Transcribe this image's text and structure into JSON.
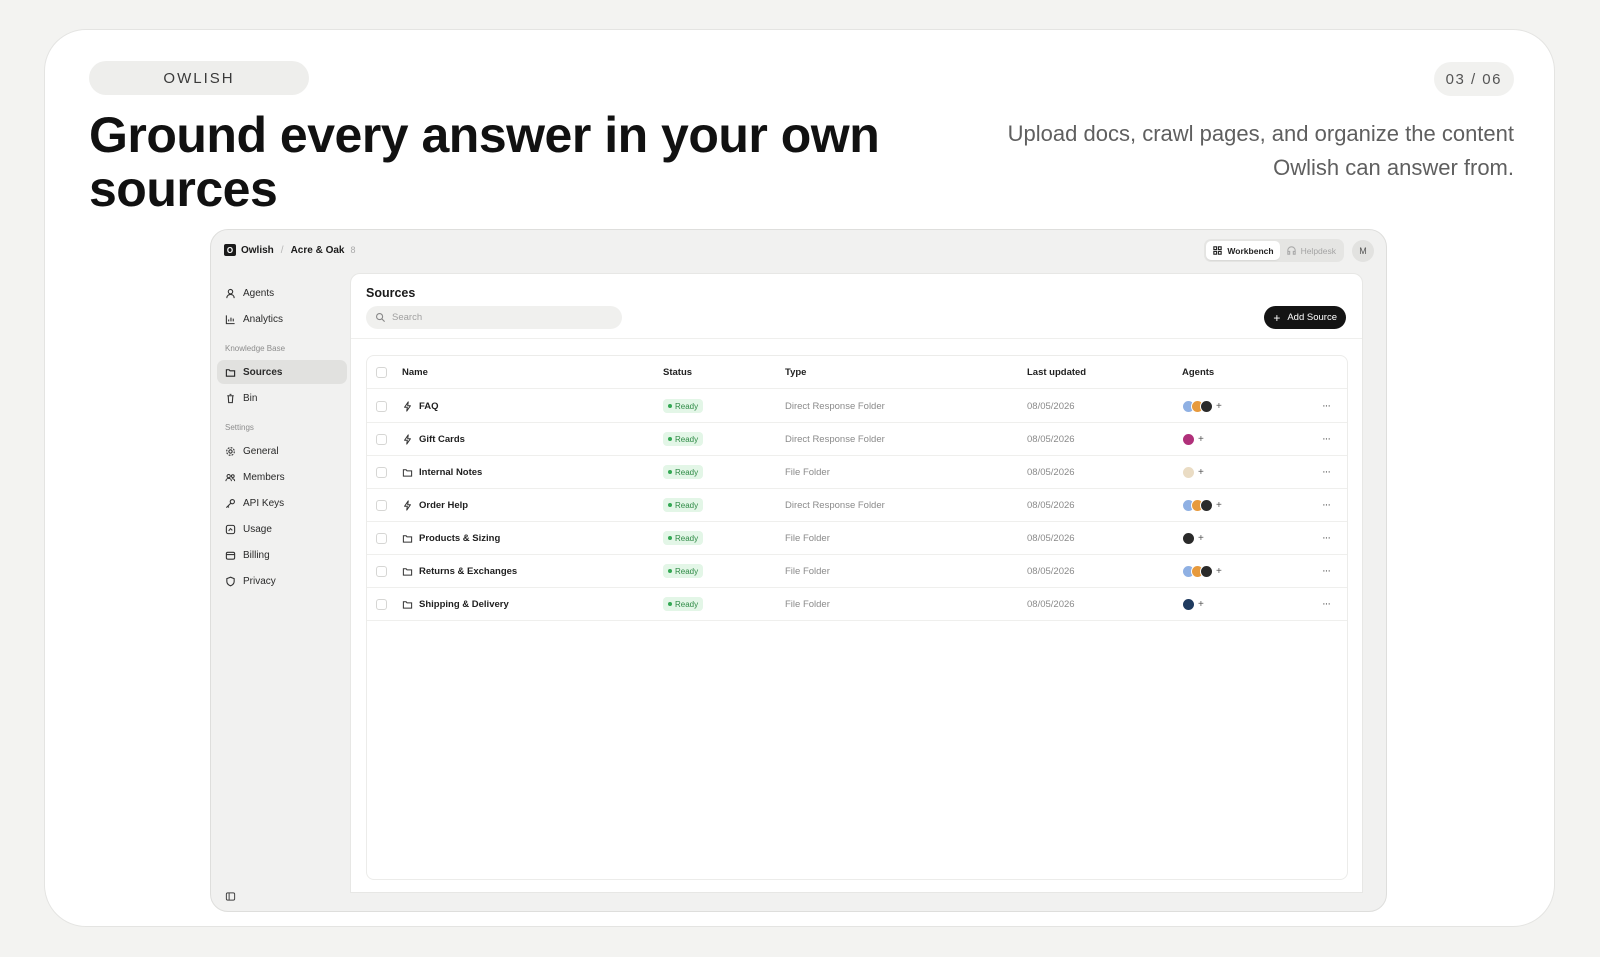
{
  "slide": {
    "brand": "OWLISH",
    "page": "03 / 06",
    "headline": "Ground every answer in your own sources",
    "subtext": "Upload docs, crawl pages, and organize the content Owlish can answer from."
  },
  "app": {
    "breadcrumb": {
      "org": "Owlish",
      "workspace": "Acre & Oak",
      "suffix": "8"
    },
    "mode_tabs": [
      {
        "label": "Workbench",
        "active": true,
        "icon": "workbench-icon"
      },
      {
        "label": "Helpdesk",
        "active": false,
        "icon": "headset-icon"
      }
    ],
    "user_initial": "M",
    "sidebar": {
      "top_items": [
        {
          "label": "Agents",
          "icon": "agent-icon"
        },
        {
          "label": "Analytics",
          "icon": "chart-icon"
        }
      ],
      "knowledge_heading": "Knowledge Base",
      "knowledge_items": [
        {
          "label": "Sources",
          "icon": "folder-icon",
          "active": true
        },
        {
          "label": "Bin",
          "icon": "trash-icon",
          "active": false
        }
      ],
      "settings_heading": "Settings",
      "settings_items": [
        {
          "label": "General",
          "icon": "gear-icon"
        },
        {
          "label": "Members",
          "icon": "users-icon"
        },
        {
          "label": "API Keys",
          "icon": "key-icon"
        },
        {
          "label": "Usage",
          "icon": "gauge-icon"
        },
        {
          "label": "Billing",
          "icon": "billing-icon"
        },
        {
          "label": "Privacy",
          "icon": "shield-icon"
        }
      ]
    },
    "main": {
      "title": "Sources",
      "search_placeholder": "Search",
      "add_button": "Add Source",
      "columns": {
        "name": "Name",
        "status": "Status",
        "type": "Type",
        "updated": "Last updated",
        "agents": "Agents"
      },
      "rows": [
        {
          "name": "FAQ",
          "kind": "bolt",
          "status": "Ready",
          "type": "Direct Response Folder",
          "updated": "08/05/2026",
          "agents": [
            "#8fb0e3",
            "#e79a3d",
            "#2a2a2a"
          ]
        },
        {
          "name": "Gift Cards",
          "kind": "bolt",
          "status": "Ready",
          "type": "Direct Response Folder",
          "updated": "08/05/2026",
          "agents": [
            "#b0307a"
          ]
        },
        {
          "name": "Internal Notes",
          "kind": "folder",
          "status": "Ready",
          "type": "File Folder",
          "updated": "08/05/2026",
          "agents": [
            "#eadcc4"
          ]
        },
        {
          "name": "Order Help",
          "kind": "bolt",
          "status": "Ready",
          "type": "Direct Response Folder",
          "updated": "08/05/2026",
          "agents": [
            "#8fb0e3",
            "#e79a3d",
            "#2a2a2a"
          ]
        },
        {
          "name": "Products & Sizing",
          "kind": "folder",
          "status": "Ready",
          "type": "File Folder",
          "updated": "08/05/2026",
          "agents": [
            "#2a2a2a"
          ]
        },
        {
          "name": "Returns & Exchanges",
          "kind": "folder",
          "status": "Ready",
          "type": "File Folder",
          "updated": "08/05/2026",
          "agents": [
            "#8fb0e3",
            "#e79a3d",
            "#2a2a2a"
          ]
        },
        {
          "name": "Shipping & Delivery",
          "kind": "folder",
          "status": "Ready",
          "type": "File Folder",
          "updated": "08/05/2026",
          "agents": [
            "#1f3a5f"
          ]
        }
      ],
      "agent_add_symbol": "+",
      "row_menu_symbol": "···"
    },
    "colors": {
      "ready_badge_bg": "#e3f6e7",
      "ready_badge_text": "#2e8a45",
      "primary_button": "#141414"
    }
  }
}
